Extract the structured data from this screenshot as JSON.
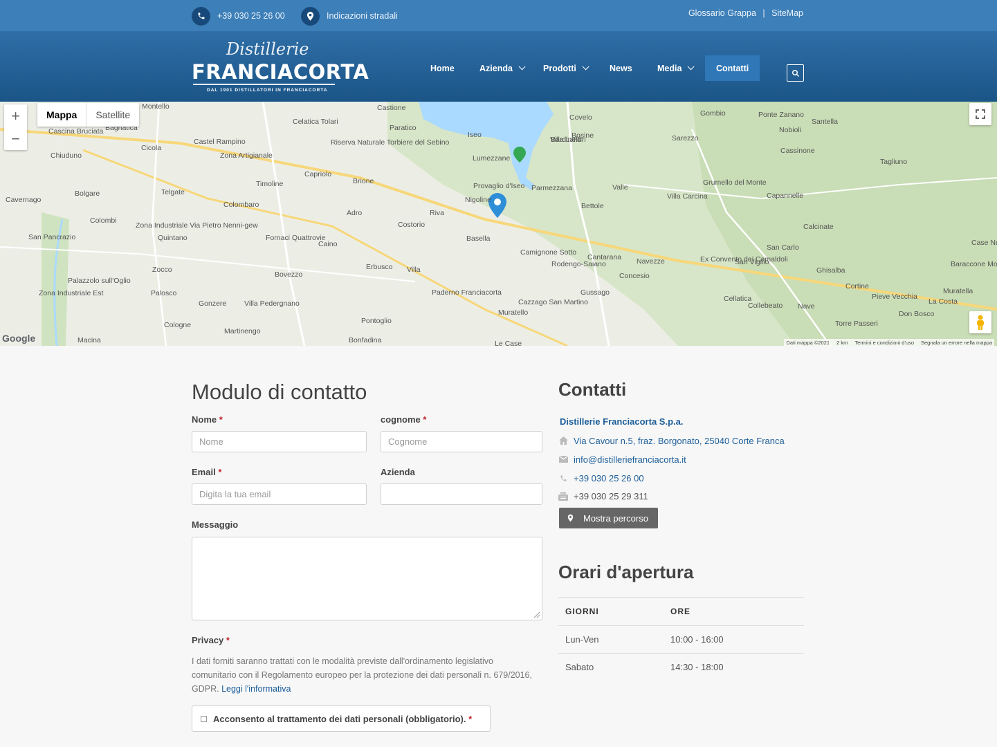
{
  "topbar": {
    "phone": "+39 030 25 26 00",
    "directions": "Indicazioni stradali",
    "glossary": "Glossario Grappa",
    "separator": "|",
    "sitemap": "SiteMap"
  },
  "logo": {
    "script": "Distillerie",
    "main": "FRANCIACORTA",
    "tagline": "DAL 1901 DISTILLATORI IN FRANCIACORTA"
  },
  "nav": {
    "home": "Home",
    "azienda": "Azienda",
    "prodotti": "Prodotti",
    "news": "News",
    "media": "Media",
    "contatti": "Contatti"
  },
  "map": {
    "tabs": [
      "Mappa",
      "Satellite"
    ],
    "places": [
      "Montello",
      "Castione",
      "Gombio",
      "Ponte Zanano",
      "Santella",
      "Cascina Bruciata",
      "Bagnatica",
      "Celatica Tolari",
      "Paratico",
      "Covelo",
      "Nobioli",
      "Bosine",
      "Villa Landri",
      "Cicola",
      "Castel Rampino",
      "Riserva Naturale Torbiere del Sebino",
      "Iseo",
      "Bardinelli",
      "Sarezzo",
      "Cassinone",
      "Chiuduno",
      "Zona Artigianale",
      "Lumezzane",
      "Tagliuno",
      "Capriolo",
      "Brione",
      "Grumello del Monte",
      "Timoline",
      "Provaglio d'Iseo",
      "Parmezzana",
      "Valle",
      "Villa Carcina",
      "Capannelle",
      "Cavernago",
      "Bolgare",
      "Telgate",
      "Colombaro",
      "Nigoline",
      "Riva",
      "Bettole",
      "Colombi",
      "Adro",
      "Costorio",
      "Calcinate",
      "Zona Industriale Via Pietro Nenni-gew",
      "Quintano",
      "Fornaci Quattrovie",
      "Basella",
      "San Pancrazio",
      "Caino",
      "Case Nuove",
      "Camignone Sotto",
      "Cantarana",
      "Navezze",
      "Ex Convento dei Camaldoli",
      "San Vigilio",
      "San Carlo",
      "Baraccone Mornico Al Serio",
      "Zocco",
      "Erbusco",
      "Villa",
      "Rodengo-Saiano",
      "Concesio",
      "Ghisalba",
      "Palazzolo sull'Oglio",
      "Bovezzo",
      "Cortine",
      "Pieve Vecchia",
      "Muratella",
      "Zona Industriale Est",
      "Palosco",
      "Gonzere",
      "Villa Pedergnano",
      "Paderno Franciacorta",
      "Gussago",
      "Cellatica",
      "Collebeato",
      "Nave",
      "La Costa",
      "Cazzago San Martino",
      "Muratello",
      "Don Bosco",
      "Torre Passeri",
      "Cologne",
      "Pontoglio",
      "Martinengo",
      "Macina",
      "Bonfadina",
      "Le Case"
    ],
    "google": "Google",
    "attribution": [
      "Dati mappa ©2021",
      "2 km",
      "Termini e condizioni d'uso",
      "Segnala un errore nella mappa"
    ]
  },
  "form": {
    "title": "Modulo di contatto",
    "nome_label": "Nome",
    "nome_placeholder": "Nome",
    "cognome_label": "cognome",
    "cognome_placeholder": "Cognome",
    "email_label": "Email",
    "email_placeholder": "Digita la tua email",
    "azienda_label": "Azienda",
    "azienda_placeholder": "",
    "messaggio_label": "Messaggio",
    "privacy_label": "Privacy",
    "required_mark": "*",
    "privacy_text": "I dati forniti saranno trattati con le modalità previste dall'ordinamento legislativo comunitario con il Regolamento europeo per la protezione dei dati personali n. 679/2016, GDPR.",
    "privacy_link": "Leggi l'informativa",
    "consent": "Acconsento al trattamento dei dati personali (obbligatorio)."
  },
  "contacts": {
    "title": "Contatti",
    "company": "Distillerie Franciacorta S.p.a.",
    "address": "Via Cavour n.5, fraz. Borgonato, 25040 Corte Franca",
    "email": "info@distilleriefranciacorta.it",
    "phone": "+39 030 25 26 00",
    "fax": "+39 030 25 29 311",
    "route_button": "Mostra percorso"
  },
  "hours": {
    "title": "Orari d'apertura",
    "col_days": "GIORNI",
    "col_hours": "ORE",
    "rows": [
      {
        "day": "Lun-Ven",
        "time": "10:00 - 16:00"
      },
      {
        "day": "Sabato",
        "time": "14:30 - 18:00"
      }
    ]
  },
  "colors": {
    "topbar": "#3d7fb8",
    "header": "#1b5587",
    "link": "#1d5f9a",
    "required": "#c0262d",
    "lake": "#aadaff",
    "marker": "#2f8ed8"
  }
}
